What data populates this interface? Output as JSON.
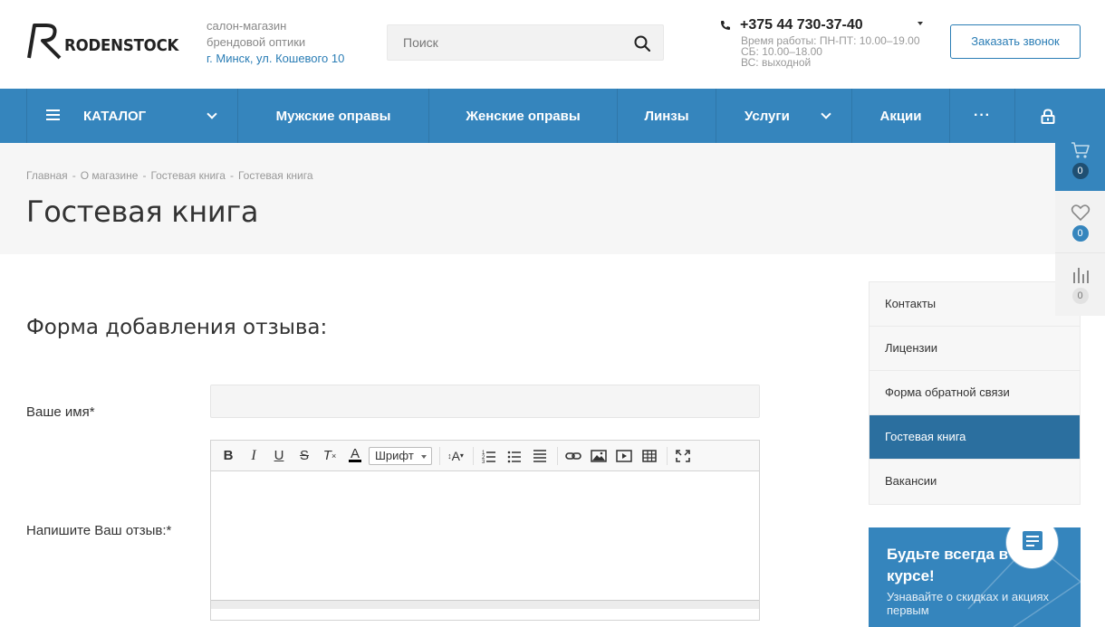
{
  "header": {
    "logo_text": "RODENSTOCK",
    "store_line1": "салон-магазин",
    "store_line2": "брендовой оптики",
    "store_address": "г. Минск, ул. Кошевого 10",
    "search_placeholder": "Поиск",
    "phone": "+375 44 730-37-40",
    "hours_line1": "Время работы: ПН-ПТ: 10.00–19.00",
    "hours_line2": "СБ: 10.00–18.00",
    "hours_line3": "ВС: выходной",
    "callback_label": "Заказать звонок"
  },
  "nav": {
    "catalog": "КАТАЛОГ",
    "men": "Мужские оправы",
    "women": "Женские оправы",
    "lenses": "Линзы",
    "services": "Услуги",
    "promo": "Акции",
    "more": "···"
  },
  "breadcrumbs": [
    "Главная",
    "О магазине",
    "Гостевая книга",
    "Гостевая книга"
  ],
  "page_title": "Гостевая книга",
  "widgets": {
    "cart_count": "0",
    "fav_count": "0",
    "compare_count": "0"
  },
  "form": {
    "title": "Форма добавления отзыва:",
    "name_label": "Ваше имя*",
    "review_label": "Напишите Ваш отзыв:*",
    "font_select": "Шрифт"
  },
  "side_menu": [
    {
      "label": "Контакты"
    },
    {
      "label": "Лицензии"
    },
    {
      "label": "Форма обратной связи"
    },
    {
      "label": "Гостевая книга"
    },
    {
      "label": "Вакансии"
    }
  ],
  "promo": {
    "title": "Будьте всегда в курсе!",
    "text": "Узнавайте о скидках и акциях первым"
  },
  "colors": {
    "accent": "#3585bd",
    "active": "#2b6f9f",
    "link": "#2a7db5"
  }
}
